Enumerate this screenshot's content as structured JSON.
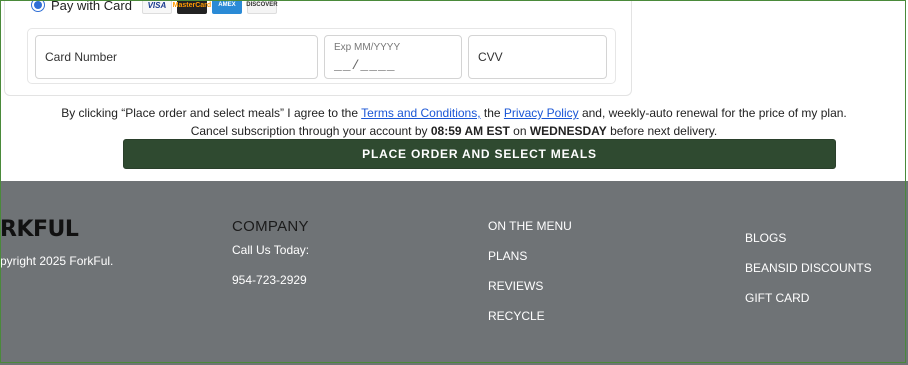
{
  "payment": {
    "method_label": "Pay with Card",
    "card_logos": [
      "VISA",
      "MasterCard",
      "AMEX",
      "DISCOVER"
    ],
    "fields": {
      "card_number_label": "Card Number",
      "exp_label": "Exp MM/YYYY",
      "exp_mask": "__/____",
      "cvv_label": "CVV"
    }
  },
  "terms": {
    "prefix": "By clicking “Place order and select meals” I agree to the",
    "terms_link": "Terms and Conditions,",
    "mid": "the",
    "privacy_link": "Privacy Policy",
    "suffix": "and, weekly-auto renewal for the price of my plan.",
    "line2_prefix": "Cancel subscription through your account by",
    "time": "08:59 AM EST",
    "on": "on",
    "day": "WEDNESDAY",
    "line2_suffix": "before next delivery."
  },
  "place_button_label": "PLACE ORDER AND SELECT MEALS",
  "footer": {
    "brand": "RKFUL",
    "copyright": "pyright 2025 ForkFul.",
    "company_heading": "COMPANY",
    "call_label": "Call Us Today:",
    "phone": "954-723-2929",
    "links_col1": [
      "ON THE MENU",
      "PLANS",
      "REVIEWS",
      "RECYCLE"
    ],
    "links_col2": [
      "BLOGS",
      "BEANSID DISCOUNTS",
      "GIFT CARD"
    ]
  },
  "colors": {
    "button_bg": "#2f4a30",
    "footer_bg": "#6f7376",
    "link": "#1a56d6"
  }
}
